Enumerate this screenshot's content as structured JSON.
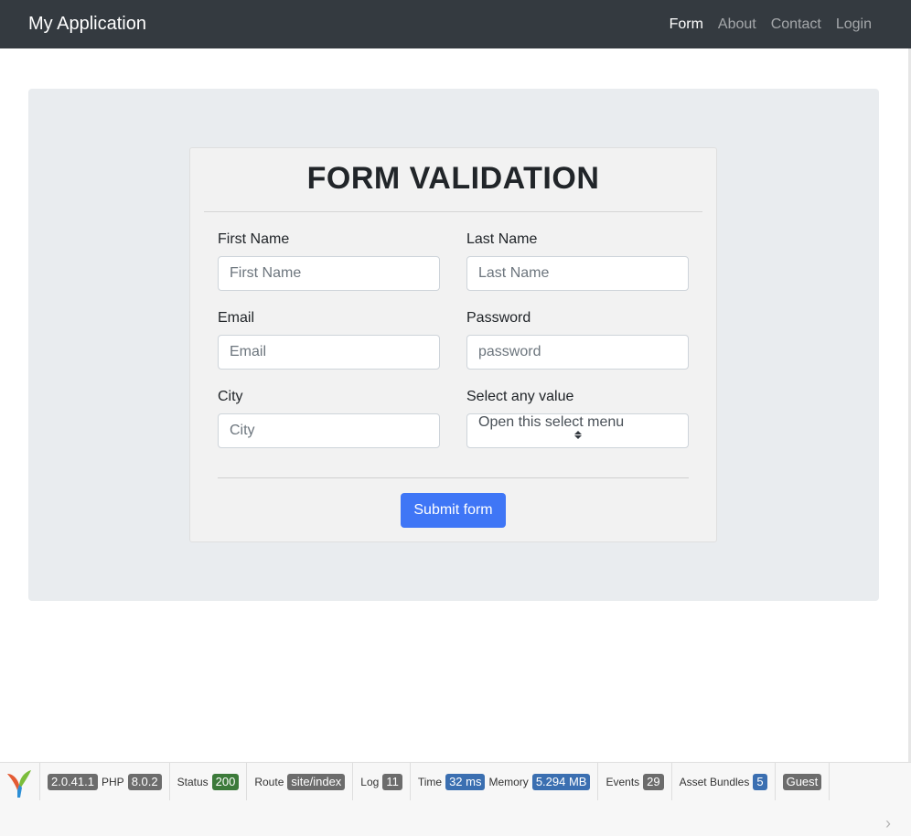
{
  "nav": {
    "brand": "My Application",
    "links": [
      {
        "label": "Form",
        "active": true
      },
      {
        "label": "About"
      },
      {
        "label": "Contact"
      },
      {
        "label": "Login"
      }
    ]
  },
  "form": {
    "title": "FORM VALIDATION",
    "fields": {
      "first_name": {
        "label": "First Name",
        "placeholder": "First Name"
      },
      "last_name": {
        "label": "Last Name",
        "placeholder": "Last Name"
      },
      "email": {
        "label": "Email",
        "placeholder": "Email"
      },
      "password": {
        "label": "Password",
        "placeholder": "password"
      },
      "city": {
        "label": "City",
        "placeholder": "City"
      },
      "select": {
        "label": "Select any value",
        "selected": "Open this select menu"
      }
    },
    "submit_label": "Submit form"
  },
  "debug": {
    "version": "2.0.41.1",
    "php_label": "PHP",
    "php_version": "8.0.2",
    "status_label": "Status",
    "status_value": "200",
    "route_label": "Route",
    "route_value": "site/index",
    "log_label": "Log",
    "log_value": "11",
    "time_label": "Time",
    "time_value": "32 ms",
    "memory_label": "Memory",
    "memory_value": "5.294 MB",
    "events_label": "Events",
    "events_value": "29",
    "assets_label": "Asset Bundles",
    "assets_value": "5",
    "user": "Guest",
    "collapse_icon": "›"
  },
  "colors": {
    "navbar": "#343a40",
    "primary": "#3f76f6",
    "jumbotron": "#e9ecef",
    "badge_green": "#3c7a3a",
    "badge_blue": "#3b6fb1",
    "badge_grey": "#6c6c6c"
  }
}
